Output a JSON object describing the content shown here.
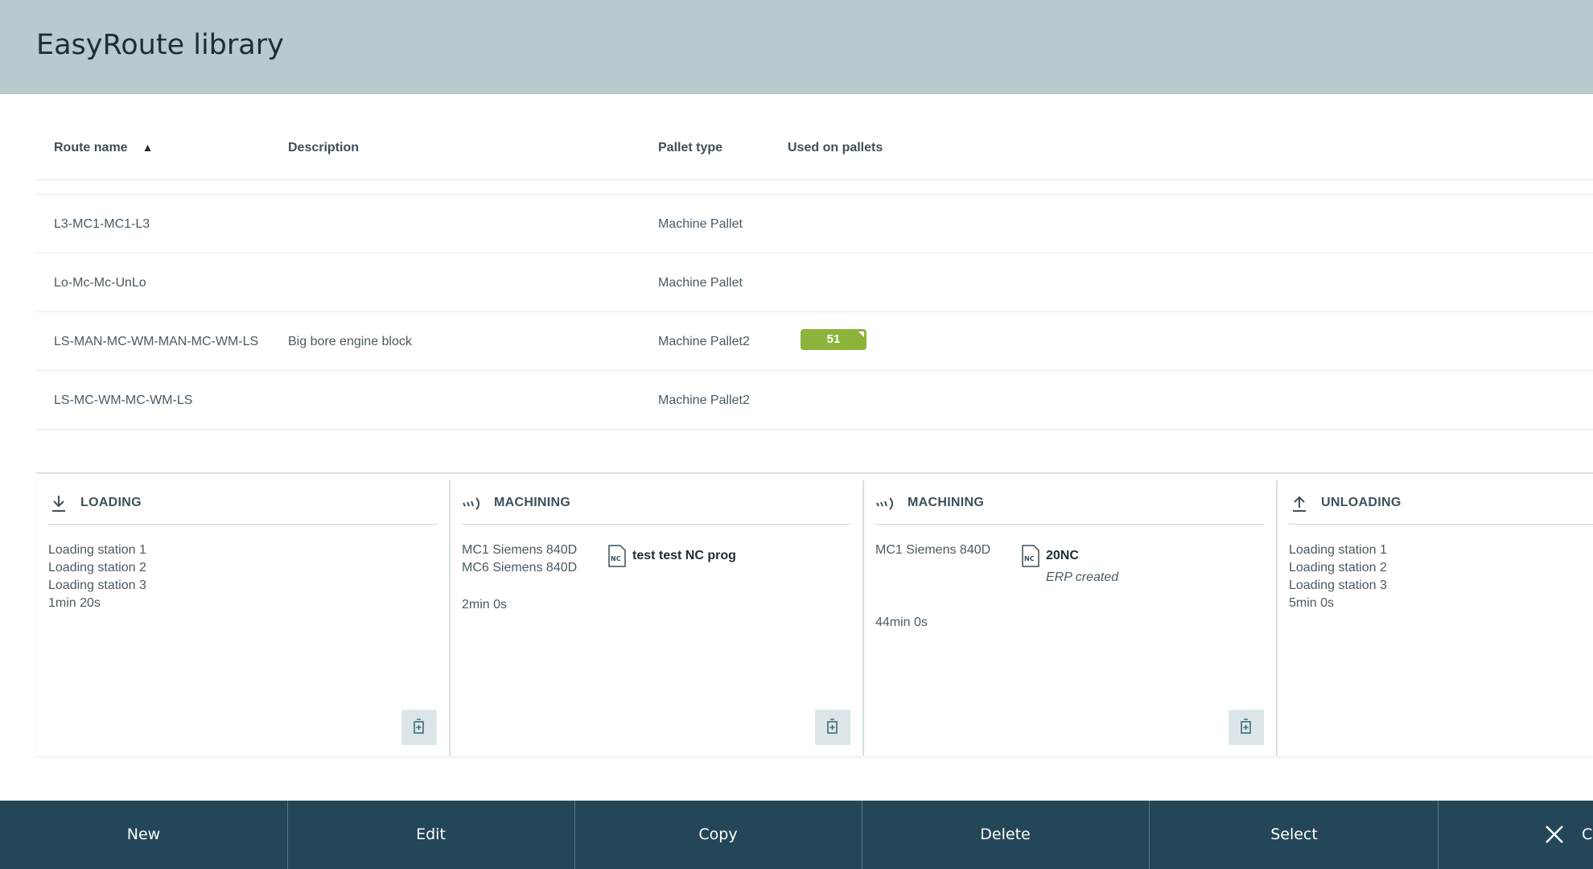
{
  "app": {
    "title": "EasyRoute library"
  },
  "table": {
    "headers": {
      "route_name": "Route name",
      "description": "Description",
      "pallet_type": "Pallet type",
      "used_on_pallets": "Used on pallets"
    },
    "sort_indicator": "▲",
    "rows": [
      {
        "route_name": "L3-MC1-MC1-L3",
        "description": "",
        "pallet_type": "Machine Pallet",
        "used_on_pallets": ""
      },
      {
        "route_name": "Lo-Mc-Mc-UnLo",
        "description": "",
        "pallet_type": "Machine Pallet",
        "used_on_pallets": ""
      },
      {
        "route_name": "LS-MAN-MC-WM-MAN-MC-WM-LS",
        "description": "Big bore engine block",
        "pallet_type": "Machine Pallet2",
        "used_on_pallets": "51"
      },
      {
        "route_name": "LS-MC-WM-MC-WM-LS",
        "description": "",
        "pallet_type": "Machine Pallet2",
        "used_on_pallets": ""
      }
    ]
  },
  "steps": [
    {
      "title": "LOADING",
      "icon": "download-icon",
      "stations": [
        "Loading station 1",
        "Loading station 2",
        "Loading station 3"
      ],
      "duration": "1min 20s"
    },
    {
      "title": "MACHINING",
      "icon": "machining-icon",
      "stations": [
        "MC1 Siemens 840D",
        "MC6 Siemens 840D"
      ],
      "nc_program": "test test NC prog",
      "nc_note": "",
      "duration": "2min 0s"
    },
    {
      "title": "MACHINING",
      "icon": "machining-icon",
      "stations": [
        "MC1 Siemens 840D"
      ],
      "nc_program": "20NC",
      "nc_note": "ERP created",
      "duration": "44min 0s"
    },
    {
      "title": "UNLOADING",
      "icon": "upload-icon",
      "stations": [
        "Loading station 1",
        "Loading station 2",
        "Loading station 3"
      ],
      "duration": "5min 0s"
    }
  ],
  "toolbar": {
    "new": "New",
    "edit": "Edit",
    "copy": "Copy",
    "delete": "Delete",
    "select": "Select",
    "close": "C"
  },
  "colors": {
    "header_bg": "#b8cace",
    "toolbar_bg": "#234758",
    "badge_green": "#8cb33c"
  }
}
